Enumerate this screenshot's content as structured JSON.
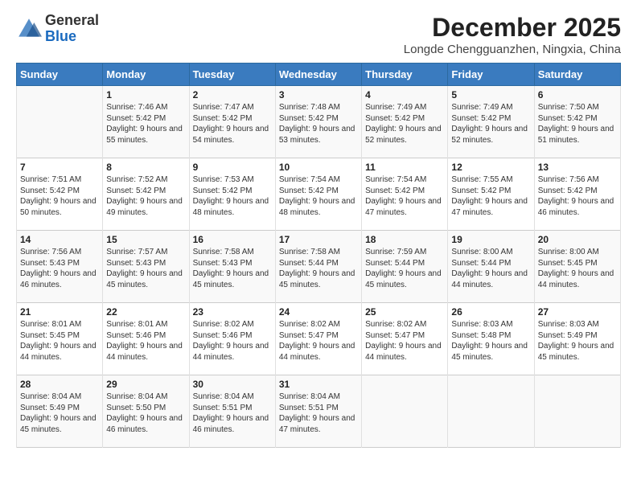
{
  "header": {
    "logo_general": "General",
    "logo_blue": "Blue",
    "month_year": "December 2025",
    "location": "Longde Chengguanzhen, Ningxia, China"
  },
  "days_of_week": [
    "Sunday",
    "Monday",
    "Tuesday",
    "Wednesday",
    "Thursday",
    "Friday",
    "Saturday"
  ],
  "weeks": [
    [
      {
        "day": "",
        "sunrise": "",
        "sunset": "",
        "daylight": ""
      },
      {
        "day": "1",
        "sunrise": "Sunrise: 7:46 AM",
        "sunset": "Sunset: 5:42 PM",
        "daylight": "Daylight: 9 hours and 55 minutes."
      },
      {
        "day": "2",
        "sunrise": "Sunrise: 7:47 AM",
        "sunset": "Sunset: 5:42 PM",
        "daylight": "Daylight: 9 hours and 54 minutes."
      },
      {
        "day": "3",
        "sunrise": "Sunrise: 7:48 AM",
        "sunset": "Sunset: 5:42 PM",
        "daylight": "Daylight: 9 hours and 53 minutes."
      },
      {
        "day": "4",
        "sunrise": "Sunrise: 7:49 AM",
        "sunset": "Sunset: 5:42 PM",
        "daylight": "Daylight: 9 hours and 52 minutes."
      },
      {
        "day": "5",
        "sunrise": "Sunrise: 7:49 AM",
        "sunset": "Sunset: 5:42 PM",
        "daylight": "Daylight: 9 hours and 52 minutes."
      },
      {
        "day": "6",
        "sunrise": "Sunrise: 7:50 AM",
        "sunset": "Sunset: 5:42 PM",
        "daylight": "Daylight: 9 hours and 51 minutes."
      }
    ],
    [
      {
        "day": "7",
        "sunrise": "Sunrise: 7:51 AM",
        "sunset": "Sunset: 5:42 PM",
        "daylight": "Daylight: 9 hours and 50 minutes."
      },
      {
        "day": "8",
        "sunrise": "Sunrise: 7:52 AM",
        "sunset": "Sunset: 5:42 PM",
        "daylight": "Daylight: 9 hours and 49 minutes."
      },
      {
        "day": "9",
        "sunrise": "Sunrise: 7:53 AM",
        "sunset": "Sunset: 5:42 PM",
        "daylight": "Daylight: 9 hours and 48 minutes."
      },
      {
        "day": "10",
        "sunrise": "Sunrise: 7:54 AM",
        "sunset": "Sunset: 5:42 PM",
        "daylight": "Daylight: 9 hours and 48 minutes."
      },
      {
        "day": "11",
        "sunrise": "Sunrise: 7:54 AM",
        "sunset": "Sunset: 5:42 PM",
        "daylight": "Daylight: 9 hours and 47 minutes."
      },
      {
        "day": "12",
        "sunrise": "Sunrise: 7:55 AM",
        "sunset": "Sunset: 5:42 PM",
        "daylight": "Daylight: 9 hours and 47 minutes."
      },
      {
        "day": "13",
        "sunrise": "Sunrise: 7:56 AM",
        "sunset": "Sunset: 5:42 PM",
        "daylight": "Daylight: 9 hours and 46 minutes."
      }
    ],
    [
      {
        "day": "14",
        "sunrise": "Sunrise: 7:56 AM",
        "sunset": "Sunset: 5:43 PM",
        "daylight": "Daylight: 9 hours and 46 minutes."
      },
      {
        "day": "15",
        "sunrise": "Sunrise: 7:57 AM",
        "sunset": "Sunset: 5:43 PM",
        "daylight": "Daylight: 9 hours and 45 minutes."
      },
      {
        "day": "16",
        "sunrise": "Sunrise: 7:58 AM",
        "sunset": "Sunset: 5:43 PM",
        "daylight": "Daylight: 9 hours and 45 minutes."
      },
      {
        "day": "17",
        "sunrise": "Sunrise: 7:58 AM",
        "sunset": "Sunset: 5:44 PM",
        "daylight": "Daylight: 9 hours and 45 minutes."
      },
      {
        "day": "18",
        "sunrise": "Sunrise: 7:59 AM",
        "sunset": "Sunset: 5:44 PM",
        "daylight": "Daylight: 9 hours and 45 minutes."
      },
      {
        "day": "19",
        "sunrise": "Sunrise: 8:00 AM",
        "sunset": "Sunset: 5:44 PM",
        "daylight": "Daylight: 9 hours and 44 minutes."
      },
      {
        "day": "20",
        "sunrise": "Sunrise: 8:00 AM",
        "sunset": "Sunset: 5:45 PM",
        "daylight": "Daylight: 9 hours and 44 minutes."
      }
    ],
    [
      {
        "day": "21",
        "sunrise": "Sunrise: 8:01 AM",
        "sunset": "Sunset: 5:45 PM",
        "daylight": "Daylight: 9 hours and 44 minutes."
      },
      {
        "day": "22",
        "sunrise": "Sunrise: 8:01 AM",
        "sunset": "Sunset: 5:46 PM",
        "daylight": "Daylight: 9 hours and 44 minutes."
      },
      {
        "day": "23",
        "sunrise": "Sunrise: 8:02 AM",
        "sunset": "Sunset: 5:46 PM",
        "daylight": "Daylight: 9 hours and 44 minutes."
      },
      {
        "day": "24",
        "sunrise": "Sunrise: 8:02 AM",
        "sunset": "Sunset: 5:47 PM",
        "daylight": "Daylight: 9 hours and 44 minutes."
      },
      {
        "day": "25",
        "sunrise": "Sunrise: 8:02 AM",
        "sunset": "Sunset: 5:47 PM",
        "daylight": "Daylight: 9 hours and 44 minutes."
      },
      {
        "day": "26",
        "sunrise": "Sunrise: 8:03 AM",
        "sunset": "Sunset: 5:48 PM",
        "daylight": "Daylight: 9 hours and 45 minutes."
      },
      {
        "day": "27",
        "sunrise": "Sunrise: 8:03 AM",
        "sunset": "Sunset: 5:49 PM",
        "daylight": "Daylight: 9 hours and 45 minutes."
      }
    ],
    [
      {
        "day": "28",
        "sunrise": "Sunrise: 8:04 AM",
        "sunset": "Sunset: 5:49 PM",
        "daylight": "Daylight: 9 hours and 45 minutes."
      },
      {
        "day": "29",
        "sunrise": "Sunrise: 8:04 AM",
        "sunset": "Sunset: 5:50 PM",
        "daylight": "Daylight: 9 hours and 46 minutes."
      },
      {
        "day": "30",
        "sunrise": "Sunrise: 8:04 AM",
        "sunset": "Sunset: 5:51 PM",
        "daylight": "Daylight: 9 hours and 46 minutes."
      },
      {
        "day": "31",
        "sunrise": "Sunrise: 8:04 AM",
        "sunset": "Sunset: 5:51 PM",
        "daylight": "Daylight: 9 hours and 47 minutes."
      },
      {
        "day": "",
        "sunrise": "",
        "sunset": "",
        "daylight": ""
      },
      {
        "day": "",
        "sunrise": "",
        "sunset": "",
        "daylight": ""
      },
      {
        "day": "",
        "sunrise": "",
        "sunset": "",
        "daylight": ""
      }
    ]
  ]
}
